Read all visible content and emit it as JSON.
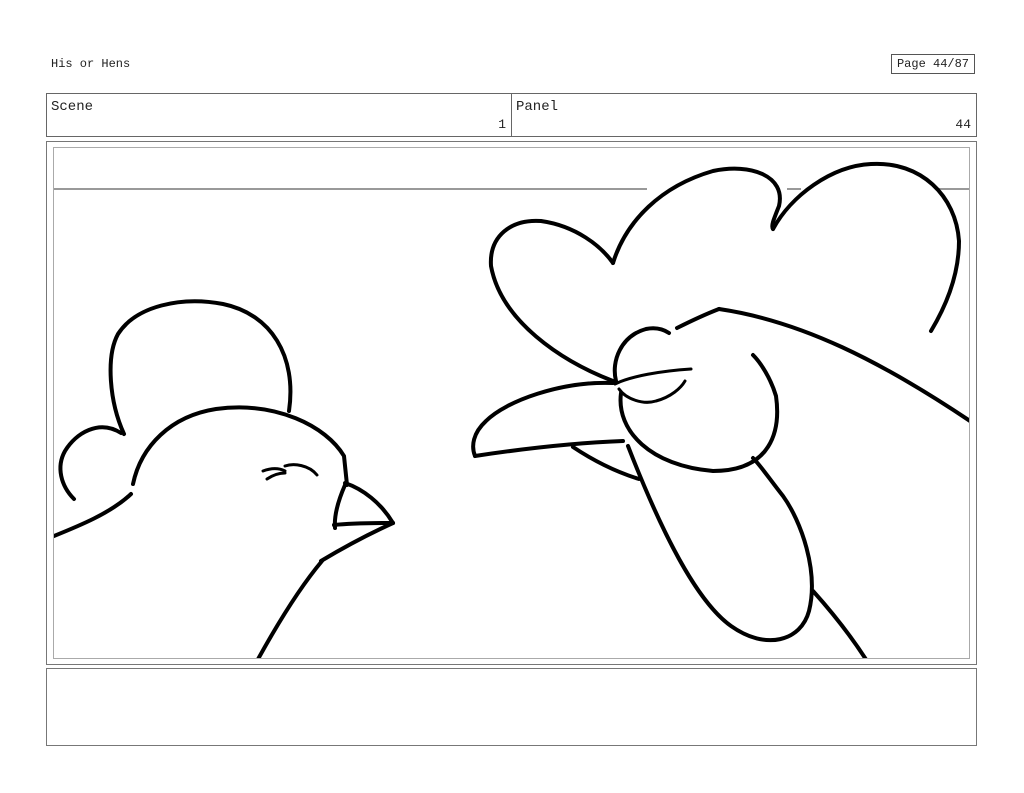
{
  "header": {
    "title": "His or Hens",
    "page_label": "Page 44/87"
  },
  "scene": {
    "label": "Scene",
    "value": "1"
  },
  "panel": {
    "label": "Panel",
    "value": "44"
  },
  "drawing": {
    "stroke_color": "#000000",
    "guide_color": "#999999"
  }
}
